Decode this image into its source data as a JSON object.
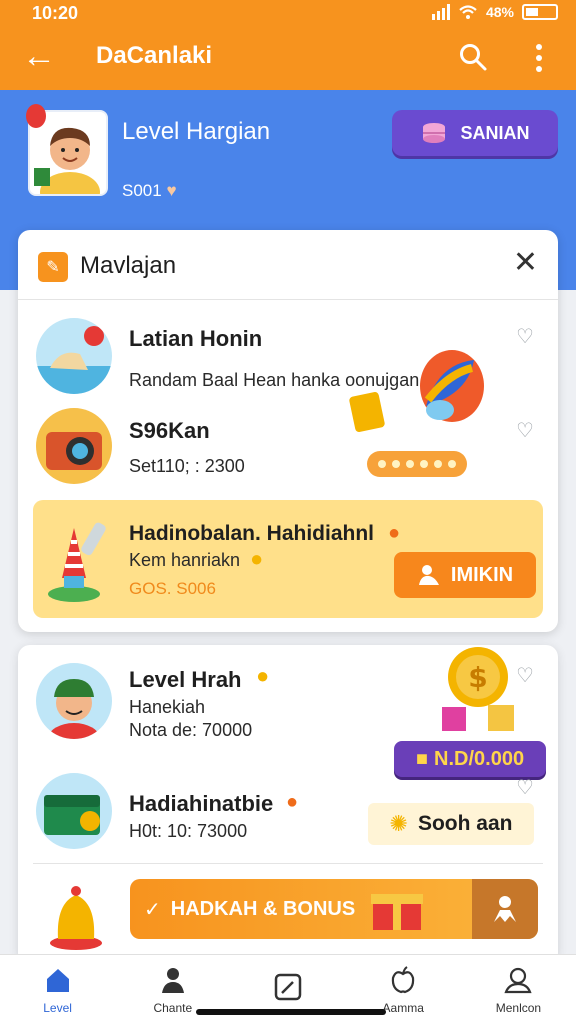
{
  "status": {
    "time": "10:20",
    "battery": "48%"
  },
  "appbar": {
    "title": "DaCanlaki"
  },
  "profile": {
    "title": "Level Hargian",
    "subtitle": "S001",
    "button_label": "SANIAN"
  },
  "modal": {
    "title": "Mavlajan",
    "rows": [
      {
        "title": "Latian Honin",
        "subtitle": "Randam Baal Hean hanka oonujgan."
      },
      {
        "title": "S96Kan",
        "subtitle": "Set110; : 2300"
      }
    ],
    "highlight": {
      "title": "Hadinobalan. Hahidiahnl",
      "subtitle": "Kem hanriakn",
      "code": "GOS. S006",
      "button_label": "IMIKIN"
    }
  },
  "card2": {
    "rows": [
      {
        "title": "Level Hrah",
        "subtitle": "Hanekiah",
        "detail": "Nota de: 70000"
      },
      {
        "title": "Hadiahinatbie",
        "detail": "H0t: 10: 73000"
      }
    ],
    "coin_badge": "N.D/0.000",
    "cream_label": "Sooh aan",
    "bonus_label": "HADKAH & BONUS"
  },
  "nav": [
    {
      "label": "Level",
      "icon": "home-icon"
    },
    {
      "label": "Chante",
      "icon": "person-icon"
    },
    {
      "label": "",
      "icon": "edit-icon"
    },
    {
      "label": "Aamma",
      "icon": "apple-icon"
    },
    {
      "label": "Menlcon",
      "icon": "user-icon"
    }
  ],
  "colors": {
    "accent": "#f7931e",
    "hero": "#4a84ea",
    "purple": "#6a4bd0",
    "active_nav": "#2f66d6"
  }
}
